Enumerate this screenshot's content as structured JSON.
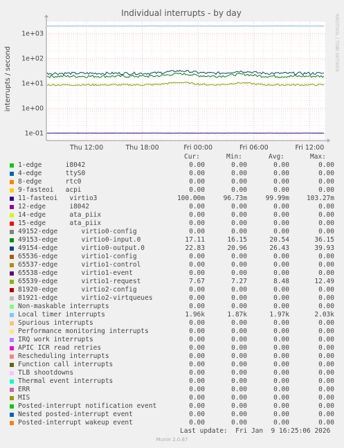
{
  "chart_data": {
    "type": "line",
    "title": "Individual interrupts - by day",
    "ylabel": "interrupts / second",
    "y_scale": "log",
    "ylim": [
      0.05,
      3000
    ],
    "y_ticks": [
      {
        "value": 1000,
        "label": "1e+03"
      },
      {
        "value": 100,
        "label": "1e+02"
      },
      {
        "value": 10,
        "label": "1e+01"
      },
      {
        "value": 1,
        "label": "1e+00"
      },
      {
        "value": 0.1,
        "label": "1e-01"
      }
    ],
    "x_ticks": [
      "Thu 12:00",
      "Thu 18:00",
      "Fri 00:00",
      "Fri 06:00",
      "Fri 12:00"
    ],
    "grid": true,
    "series_plotted": [
      {
        "name": "Local timer interrupts",
        "color": "#7EB5E8",
        "level": 1970,
        "noise": 0.01
      },
      {
        "name": "49153-edge virtio0-input.0",
        "color": "#008000",
        "level": 19,
        "noise": 0.12
      },
      {
        "name": "49154-edge virtio0-output.0",
        "color": "#00456F",
        "level": 25,
        "noise": 0.12
      },
      {
        "name": "65539-edge virtio1-request",
        "color": "#8F9F00",
        "level": 8.6,
        "noise": 0.08
      },
      {
        "name": "11-fasteoi virtio3",
        "color": "#330099",
        "level": 0.1,
        "noise": 0.005
      }
    ]
  },
  "side_label": "RRDTOOL / TOBI OETIKER",
  "legend": {
    "headers": {
      "cur": "Cur:",
      "min": "Min:",
      "avg": "Avg:",
      "max": "Max:"
    },
    "rows": [
      {
        "label": "1-edge      i8042",
        "color": "#00CC00",
        "cur": "0.00",
        "min": "0.00",
        "avg": "0.00",
        "max": "0.00"
      },
      {
        "label": "4-edge      ttyS0",
        "color": "#0066B3",
        "cur": "0.00",
        "min": "0.00",
        "avg": "0.00",
        "max": "0.00"
      },
      {
        "label": "8-edge      rtc0",
        "color": "#FF8000",
        "cur": "0.00",
        "min": "0.00",
        "avg": "0.00",
        "max": "0.00"
      },
      {
        "label": "9-fasteoi   acpi",
        "color": "#FFCC00",
        "cur": "0.00",
        "min": "0.00",
        "avg": "0.00",
        "max": "0.00"
      },
      {
        "label": "11-fasteoi   virtio3",
        "color": "#330099",
        "cur": "100.00m",
        "min": "96.73m",
        "avg": "99.99m",
        "max": "103.27m"
      },
      {
        "label": "12-edge      i8042",
        "color": "#990099",
        "cur": "0.00",
        "min": "0.00",
        "avg": "0.00",
        "max": "0.00"
      },
      {
        "label": "14-edge      ata_piix",
        "color": "#CCFF00",
        "cur": "0.00",
        "min": "0.00",
        "avg": "0.00",
        "max": "0.00"
      },
      {
        "label": "15-edge      ata_piix",
        "color": "#FF0000",
        "cur": "0.00",
        "min": "0.00",
        "avg": "0.00",
        "max": "0.00"
      },
      {
        "label": "49152-edge      virtio0-config",
        "color": "#808080",
        "cur": "0.00",
        "min": "0.00",
        "avg": "0.00",
        "max": "0.00"
      },
      {
        "label": "49153-edge      virtio0-input.0",
        "color": "#008F00",
        "cur": "17.11",
        "min": "16.15",
        "avg": "20.54",
        "max": "36.15"
      },
      {
        "label": "49154-edge      virtio0-output.0",
        "color": "#00487D",
        "cur": "22.83",
        "min": "20.96",
        "avg": "26.43",
        "max": "39.93"
      },
      {
        "label": "65536-edge      virtio1-config",
        "color": "#B35A00",
        "cur": "0.00",
        "min": "0.00",
        "avg": "0.00",
        "max": "0.00"
      },
      {
        "label": "65537-edge      virtio1-control",
        "color": "#B38F00",
        "cur": "0.00",
        "min": "0.00",
        "avg": "0.00",
        "max": "0.00"
      },
      {
        "label": "65538-edge      virtio1-event",
        "color": "#6B006B",
        "cur": "0.00",
        "min": "0.00",
        "avg": "0.00",
        "max": "0.00"
      },
      {
        "label": "65539-edge      virtio1-request",
        "color": "#8FB300",
        "cur": "7.67",
        "min": "7.27",
        "avg": "8.48",
        "max": "12.49"
      },
      {
        "label": "81920-edge      virtio2-config",
        "color": "#B30000",
        "cur": "0.00",
        "min": "0.00",
        "avg": "0.00",
        "max": "0.00"
      },
      {
        "label": "81921-edge      virtio2-virtqueues",
        "color": "#BEBEBE",
        "cur": "0.00",
        "min": "0.00",
        "avg": "0.00",
        "max": "0.00"
      },
      {
        "label": "Non-maskable interrupts",
        "color": "#80FF80",
        "cur": "0.00",
        "min": "0.00",
        "avg": "0.00",
        "max": "0.00"
      },
      {
        "label": "Local timer interrupts",
        "color": "#80C9FF",
        "cur": "1.96k",
        "min": "1.87k",
        "avg": "1.97k",
        "max": "2.03k"
      },
      {
        "label": "Spurious interrupts",
        "color": "#FFC080",
        "cur": "0.00",
        "min": "0.00",
        "avg": "0.00",
        "max": "0.00"
      },
      {
        "label": "Performance monitoring interrupts",
        "color": "#FFE680",
        "cur": "0.00",
        "min": "0.00",
        "avg": "0.00",
        "max": "0.00"
      },
      {
        "label": "IRQ work interrupts",
        "color": "#AA80FF",
        "cur": "0.00",
        "min": "0.00",
        "avg": "0.00",
        "max": "0.00"
      },
      {
        "label": "APIC ICR read retries",
        "color": "#EE00CC",
        "cur": "0.00",
        "min": "0.00",
        "avg": "0.00",
        "max": "0.00"
      },
      {
        "label": "Rescheduling interrupts",
        "color": "#FF8080",
        "cur": "0.00",
        "min": "0.00",
        "avg": "0.00",
        "max": "0.00"
      },
      {
        "label": "Function call interrupts",
        "color": "#666600",
        "cur": "0.00",
        "min": "0.00",
        "avg": "0.00",
        "max": "0.00"
      },
      {
        "label": "TLB shootdowns",
        "color": "#FFBFFF",
        "cur": "0.00",
        "min": "0.00",
        "avg": "0.00",
        "max": "0.00"
      },
      {
        "label": "Thermal event interrupts",
        "color": "#00FFCC",
        "cur": "0.00",
        "min": "0.00",
        "avg": "0.00",
        "max": "0.00"
      },
      {
        "label": "ERR",
        "color": "#CC6699",
        "cur": "0.00",
        "min": "0.00",
        "avg": "0.00",
        "max": "0.00"
      },
      {
        "label": "MIS",
        "color": "#999900",
        "cur": "0.00",
        "min": "0.00",
        "avg": "0.00",
        "max": "0.00"
      },
      {
        "label": "Posted-interrupt notification event",
        "color": "#00CC00",
        "cur": "0.00",
        "min": "0.00",
        "avg": "0.00",
        "max": "0.00"
      },
      {
        "label": "Nested posted-interrupt event",
        "color": "#0066B3",
        "cur": "0.00",
        "min": "0.00",
        "avg": "0.00",
        "max": "0.00"
      },
      {
        "label": "Posted-interrupt wakeup event",
        "color": "#FF8000",
        "cur": "0.00",
        "min": "0.00",
        "avg": "0.00",
        "max": "0.00"
      }
    ]
  },
  "footer": {
    "last_update": "Last update:  Fri Jan  9 16:25:06 2026",
    "munin": "Munin 2.0.67"
  }
}
